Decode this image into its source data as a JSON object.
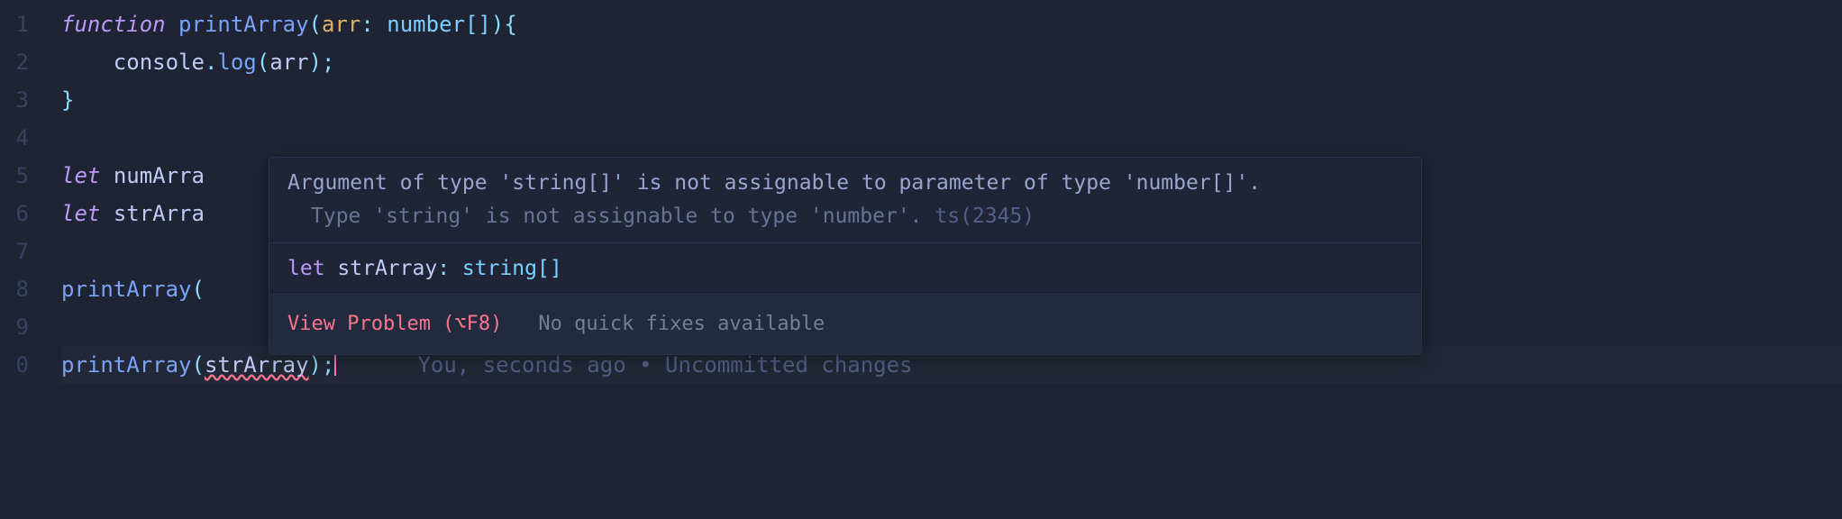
{
  "gutter": {
    "start": 1,
    "count": 10
  },
  "code": {
    "l1": {
      "keyword": "function",
      "name": "printArray",
      "param": "arr",
      "type": "number",
      "brackets": "[]",
      "brace": "{"
    },
    "l2": {
      "obj": "console",
      "method": "log",
      "arg": "arr"
    },
    "l3": {
      "brace": "}"
    },
    "l5": {
      "keyword": "let",
      "name": "numArra"
    },
    "l6": {
      "keyword": "let",
      "name": "strArra"
    },
    "l8": {
      "call": "printArray"
    },
    "l10": {
      "call": "printArray",
      "arg": "strArray"
    }
  },
  "hover": {
    "error_line1": "Argument of type 'string[]' is not assignable to parameter of type 'number[]'.",
    "error_line2": "Type 'string' is not assignable to type 'number'.",
    "error_code": "ts(2345)",
    "def_keyword": "let",
    "def_name": "strArray",
    "def_type": "string",
    "def_brackets": "[]",
    "view_problem": "View Problem (⌥F8)",
    "no_fix": "No quick fixes available"
  },
  "codelens": {
    "text": "You, seconds ago • Uncommitted changes"
  }
}
